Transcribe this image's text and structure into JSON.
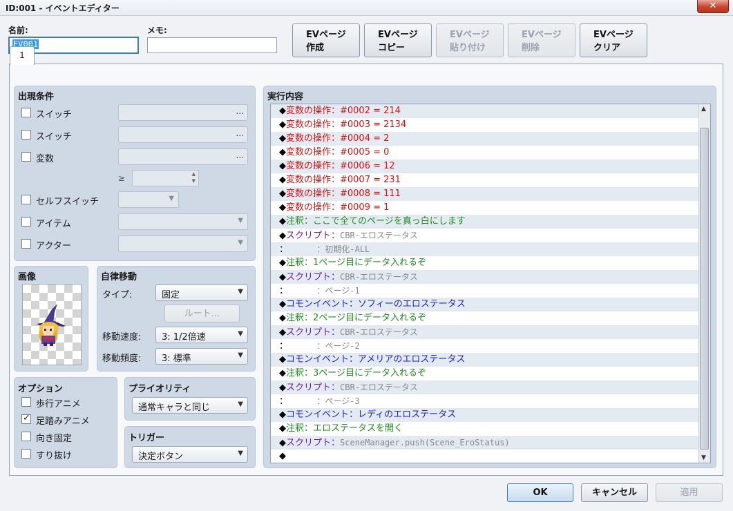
{
  "window": {
    "title": "ID:001 - イベントエディター",
    "close_glyph": "✕"
  },
  "header": {
    "name_label": "名前:",
    "name_value": "EV001",
    "memo_label": "メモ:",
    "memo_value": "",
    "buttons": [
      {
        "line1": "EVページ",
        "line2": "作成",
        "enabled": true
      },
      {
        "line1": "EVページ",
        "line2": "コピー",
        "enabled": true
      },
      {
        "line1": "EVページ",
        "line2": "貼り付け",
        "enabled": false
      },
      {
        "line1": "EVページ",
        "line2": "削除",
        "enabled": false
      },
      {
        "line1": "EVページ",
        "line2": "クリア",
        "enabled": true
      }
    ]
  },
  "tabs": [
    "1"
  ],
  "conditions": {
    "title": "出現条件",
    "switch1": "スイッチ",
    "switch2": "スイッチ",
    "variable": "変数",
    "ge": "≥",
    "self_switch": "セルフスイッチ",
    "item": "アイテム",
    "actor": "アクター",
    "dots": "..."
  },
  "image": {
    "title": "画像"
  },
  "autonomous": {
    "title": "自律移動",
    "type_label": "タイプ:",
    "type_value": "固定",
    "route_button": "ルート...",
    "speed_label": "移動速度:",
    "speed_value": "3: 1/2倍速",
    "freq_label": "移動頻度:",
    "freq_value": "3: 標準"
  },
  "options": {
    "title": "オプション",
    "items": [
      {
        "label": "歩行アニメ",
        "checked": false
      },
      {
        "label": "足踏みアニメ",
        "checked": true
      },
      {
        "label": "向き固定",
        "checked": false
      },
      {
        "label": "すり抜け",
        "checked": false
      }
    ]
  },
  "priority": {
    "title": "プライオリティ",
    "value": "通常キャラと同じ"
  },
  "trigger": {
    "title": "トリガー",
    "value": "決定ボタン"
  },
  "contents": {
    "title": "実行内容",
    "rows": [
      {
        "m": "◆",
        "text": "変数の操作：#0002 = 214",
        "color": "#dd1111"
      },
      {
        "m": "◆",
        "text": "変数の操作：#0003 = 2134",
        "color": "#dd1111"
      },
      {
        "m": "◆",
        "text": "変数の操作：#0004 = 2",
        "color": "#dd1111"
      },
      {
        "m": "◆",
        "text": "変数の操作：#0005 = 0",
        "color": "#dd1111"
      },
      {
        "m": "◆",
        "text": "変数の操作：#0006 = 12",
        "color": "#dd1111"
      },
      {
        "m": "◆",
        "text": "変数の操作：#0007 = 231",
        "color": "#dd1111"
      },
      {
        "m": "◆",
        "text": "変数の操作：#0008 = 111",
        "color": "#dd1111"
      },
      {
        "m": "◆",
        "text": "変数の操作：#0009 = 1",
        "color": "#dd1111"
      },
      {
        "m": "◆",
        "text": "注釈：ここで全てのページを真っ白にします",
        "color": "#1e8c1e"
      },
      {
        "m": "◆",
        "text": "スクリプト：",
        "color": "#6a1ba8",
        "extra": "CBR-エロステータス"
      },
      {
        "m": "：",
        "text": "          ",
        "color": "#888",
        "extra": "：初期化-ALL"
      },
      {
        "m": "◆",
        "text": "注釈：1ページ目にデータ入れるぞ",
        "color": "#1e8c1e"
      },
      {
        "m": "◆",
        "text": "スクリプト：",
        "color": "#6a1ba8",
        "extra": "CBR-エロステータス"
      },
      {
        "m": "：",
        "text": "          ",
        "color": "#888",
        "extra": "：ページ-1"
      },
      {
        "m": "◆",
        "text": "コモンイベント：ソフィーのエロステータス",
        "color": "#2222cc"
      },
      {
        "m": "◆",
        "text": "注釈：2ページ目にデータ入れるぞ",
        "color": "#1e8c1e"
      },
      {
        "m": "◆",
        "text": "スクリプト：",
        "color": "#6a1ba8",
        "extra": "CBR-エロステータス"
      },
      {
        "m": "：",
        "text": "          ",
        "color": "#888",
        "extra": "：ページ-2"
      },
      {
        "m": "◆",
        "text": "コモンイベント：アメリアのエロステータス",
        "color": "#2222cc"
      },
      {
        "m": "◆",
        "text": "注釈：3ページ目にデータ入れるぞ",
        "color": "#1e8c1e"
      },
      {
        "m": "◆",
        "text": "スクリプト：",
        "color": "#6a1ba8",
        "extra": "CBR-エロステータス"
      },
      {
        "m": "：",
        "text": "          ",
        "color": "#888",
        "extra": "：ページ-3"
      },
      {
        "m": "◆",
        "text": "コモンイベント：レディのエロステータス",
        "color": "#2222cc"
      },
      {
        "m": "◆",
        "text": "注釈：エロステータスを開く",
        "color": "#1e8c1e"
      },
      {
        "m": "◆",
        "text": "スクリプト：",
        "color": "#6a1ba8",
        "extra": "SceneManager.push(Scene_EroStatus)"
      },
      {
        "m": "◆",
        "text": "",
        "color": "#000"
      }
    ]
  },
  "footer": {
    "ok": "OK",
    "cancel": "キャンセル",
    "apply": "適用"
  }
}
